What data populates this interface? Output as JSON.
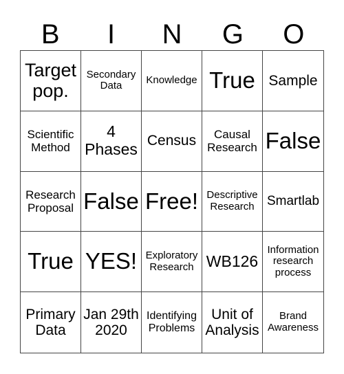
{
  "header": [
    "B",
    "I",
    "N",
    "G",
    "O"
  ],
  "cells": [
    "Target pop.",
    "Secondary Data",
    "Knowledge",
    "True",
    "Sample",
    "Scientific Method",
    "4 Phases",
    "Census",
    "Causal Research",
    "False",
    "Research Proposal",
    "False",
    "Free!",
    "Descriptive Research",
    "Smartlab",
    "True",
    "YES!",
    "Exploratory Research",
    "WB126",
    "Information research process",
    "Primary Data",
    "Jan 29th 2020",
    "Identifying Problems",
    "Unit of Analysis",
    "Brand Awareness"
  ]
}
